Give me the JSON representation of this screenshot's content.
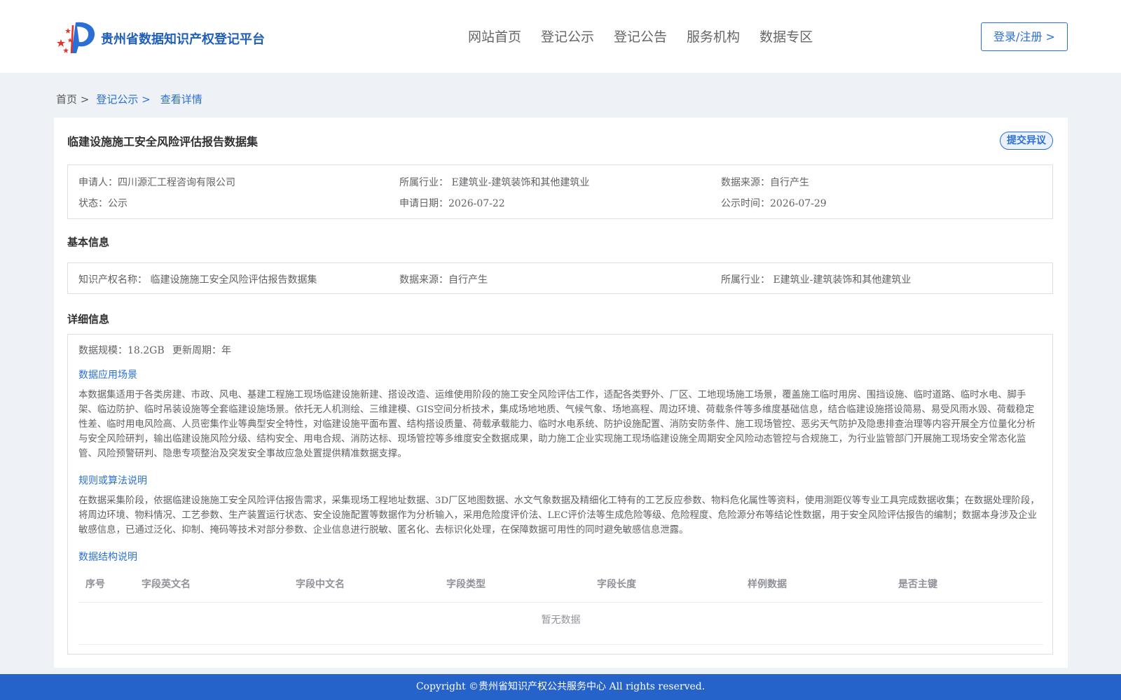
{
  "header": {
    "site_title": "贵州省数据知识产权登记平台",
    "nav": [
      "网站首页",
      "登记公示",
      "登记公告",
      "服务机构",
      "数据专区"
    ],
    "login_label": "登录/注册 >"
  },
  "breadcrumb": {
    "home": "首页 >",
    "list": "登记公示 >",
    "current": "查看详情"
  },
  "record": {
    "title": "临建设施施工安全风险评估报告数据集",
    "objection_label": "提交异议",
    "applicant": "申请人：四川源汇工程咨询有限公司",
    "industry": "所属行业： E建筑业-建筑装饰和其他建筑业",
    "source": "数据来源：自行产生",
    "status": "状态：公示",
    "apply_date": "申请日期：2026-07-22",
    "publish_time": "公示时间：2026-07-29"
  },
  "basic": {
    "section_title": "基本信息",
    "ip_name": "知识产权名称： 临建设施施工安全风险评估报告数据集",
    "source": "数据来源：自行产生",
    "industry": "所属行业： E建筑业-建筑装饰和其他建筑业"
  },
  "detail": {
    "section_title": "详细信息",
    "scale": "数据规模：18.2GB",
    "cycle": "更新周期：年",
    "scene_title": "数据应用场景",
    "scene_text": "本数据集适用于各类房建、市政、风电、基建工程施工现场临建设施新建、搭设改造、运维使用阶段的施工安全风险评估工作，适配各类野外、厂区、工地现场施工场景，覆盖施工临时用房、围挡设施、临时道路、临时水电、脚手架、临边防护、临时吊装设施等全套临建设施场景。依托无人机测绘、三维建模、GIS空间分析技术，集成场地地质、气候气象、场地高程、周边环境、荷载条件等多维度基础信息，结合临建设施搭设简易、易受风雨水毁、荷载稳定性差、临时用电风险高、人员密集作业等典型安全特性，对临建设施平面布置、结构搭设质量、荷载承载能力、临时水电系统、防护设施配置、消防安防条件、施工现场管控、恶劣天气防护及隐患排查治理等内容开展全方位量化分析与安全风险研判，输出临建设施风险分级、结构安全、用电合规、消防达标、现场管控等多维度安全数据成果，助力施工企业实现施工现场临建设施全周期安全风险动态管控与合规施工，为行业监管部门开展施工现场安全常态化监管、风险预警研判、隐患专项整治及突发安全事故应急处置提供精准数据支撑。",
    "rule_title": "规则或算法说明",
    "rule_text": "在数据采集阶段，依据临建设施施工安全风险评估报告需求，采集现场工程地址数据、3D厂区地图数据、水文气象数据及精细化工特有的工艺反应参数、物料危化属性等资料，使用测距仪等专业工具完成数据收集；在数据处理阶段，将周边环境、物料情况、工艺参数、生产装置运行状态、安全设施配置等数据作为分析输入，采用危险度评价法、LEC评价法等生成危险等级、危险程度、危险源分布等结论性数据，用于安全风险评估报告的编制；数据本身涉及企业敏感信息，已通过泛化、抑制、掩码等技术对部分参数、企业信息进行脱敏、匿名化、去标识化处理，在保障数据可用性的同时避免敏感信息泄露。",
    "structure_title": "数据结构说明",
    "columns": [
      "序号",
      "字段英文名",
      "字段中文名",
      "字段类型",
      "字段长度",
      "样例数据",
      "是否主键"
    ],
    "empty_text": "暂无数据"
  },
  "footer": {
    "copyright": "Copyright ©贵州省知识产权公共服务中心 All rights reserved."
  },
  "colors": {
    "brand": "#2a6fd6",
    "footer": "#2562c9",
    "logo_red": "#e0342b"
  }
}
